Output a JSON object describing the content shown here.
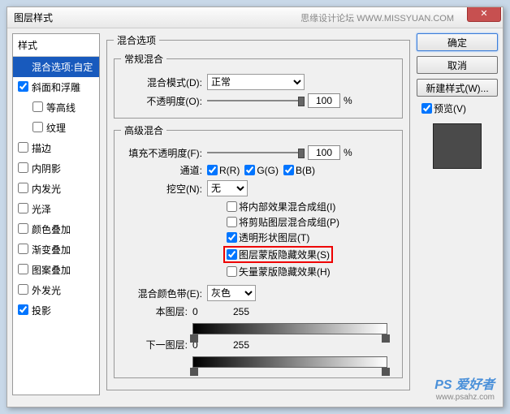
{
  "title": "图层样式",
  "subtitle": "思缘设计论坛   WWW.MISSYUAN.COM",
  "close": "✕",
  "sidebar": {
    "header": "样式",
    "items": [
      {
        "label": "混合选项:自定",
        "checked": null,
        "selected": true
      },
      {
        "label": "斜面和浮雕",
        "checked": true
      },
      {
        "label": "等高线",
        "checked": false,
        "indent": true
      },
      {
        "label": "纹理",
        "checked": false,
        "indent": true
      },
      {
        "label": "描边",
        "checked": false
      },
      {
        "label": "内阴影",
        "checked": false
      },
      {
        "label": "内发光",
        "checked": false
      },
      {
        "label": "光泽",
        "checked": false
      },
      {
        "label": "颜色叠加",
        "checked": false
      },
      {
        "label": "渐变叠加",
        "checked": false
      },
      {
        "label": "图案叠加",
        "checked": false
      },
      {
        "label": "外发光",
        "checked": false
      },
      {
        "label": "投影",
        "checked": true
      }
    ]
  },
  "main": {
    "title": "混合选项",
    "general": {
      "legend": "常规混合",
      "blendmode_label": "混合模式(D):",
      "blendmode_value": "正常",
      "opacity_label": "不透明度(O):",
      "opacity_value": "100",
      "percent": "%"
    },
    "advanced": {
      "legend": "高级混合",
      "fillopacity_label": "填充不透明度(F):",
      "fillopacity_value": "100",
      "percent": "%",
      "channel_label": "通道:",
      "ch_r": "R(R)",
      "ch_g": "G(G)",
      "ch_b": "B(B)",
      "knockout_label": "挖空(N):",
      "knockout_value": "无",
      "opts": [
        {
          "label": "将内部效果混合成组(I)",
          "checked": false
        },
        {
          "label": "将剪贴图层混合成组(P)",
          "checked": false
        },
        {
          "label": "透明形状图层(T)",
          "checked": true
        },
        {
          "label": "图层蒙版隐藏效果(S)",
          "checked": true,
          "highlight": true
        },
        {
          "label": "矢量蒙版隐藏效果(H)",
          "checked": false
        }
      ],
      "blendif_label": "混合颜色带(E):",
      "blendif_value": "灰色",
      "thislayer_label": "本图层:",
      "thislayer_lo": "0",
      "thislayer_hi": "255",
      "underlayer_label": "下一图层:",
      "underlayer_lo": "0",
      "underlayer_hi": "255"
    }
  },
  "right": {
    "ok": "确定",
    "cancel": "取消",
    "newstyle": "新建样式(W)...",
    "preview_label": "预览(V)"
  },
  "watermark": {
    "brand": "PS 爱好者",
    "url": "www.psahz.com"
  }
}
